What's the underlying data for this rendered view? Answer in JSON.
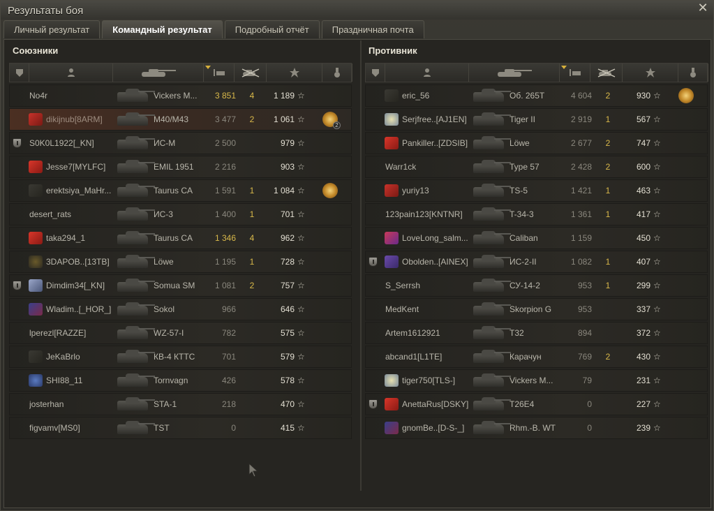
{
  "window": {
    "title": "Результаты боя"
  },
  "tabs": [
    {
      "label": "Личный результат",
      "active": false
    },
    {
      "label": "Командный результат",
      "active": true
    },
    {
      "label": "Подробный отчёт",
      "active": false
    },
    {
      "label": "Праздничная почта",
      "active": false
    }
  ],
  "colors": {
    "accent": "#d9b94a",
    "self_row": "#4b2f22",
    "row_bg": "#2a2824"
  },
  "header_icons": [
    "squad-icon",
    "player-icon",
    "tank-icon",
    "damage-icon",
    "kills-icon",
    "xp-star-icon",
    "medal-icon"
  ],
  "allies": {
    "title": "Союзники",
    "rows": [
      {
        "name": "No4r",
        "tank": "Vickers M...",
        "xp": "3 851",
        "xp_hi": true,
        "kills": "4",
        "points": "1 189",
        "squad": false,
        "badge": "",
        "medal": false,
        "self": false
      },
      {
        "name": "dikijnub[8ARM]",
        "tank": "M40/M43",
        "xp": "3 477",
        "xp_hi": false,
        "kills": "2",
        "points": "1 061",
        "squad": false,
        "badge": "ribbon-red-badge",
        "medal": true,
        "medal_count": "2",
        "self": true
      },
      {
        "name": "S0K0L1922[_KN]",
        "tank": "ИС-М",
        "xp": "2 500",
        "xp_hi": false,
        "kills": "",
        "points": "979",
        "squad": true,
        "badge": "",
        "medal": false,
        "self": false
      },
      {
        "name": "Jesse7[MYLFC]",
        "tank": "EMIL 1951",
        "xp": "2 216",
        "xp_hi": false,
        "kills": "",
        "points": "903",
        "squad": false,
        "badge": "flag-red-badge",
        "medal": false,
        "self": false
      },
      {
        "name": "erektsiya_MaHr...",
        "tank": "Taurus CA",
        "xp": "1 591",
        "xp_hi": false,
        "kills": "1",
        "points": "1 084",
        "squad": false,
        "badge": "diamond-badge",
        "medal": true,
        "self": false
      },
      {
        "name": "desert_rats",
        "tank": "ИС-3",
        "xp": "1 400",
        "xp_hi": false,
        "kills": "1",
        "points": "701",
        "squad": false,
        "badge": "",
        "medal": false,
        "self": false
      },
      {
        "name": "taka294_1",
        "tank": "Taurus CA",
        "xp": "1 346",
        "xp_hi": true,
        "kills": "4",
        "points": "962",
        "squad": false,
        "badge": "flag-red-badge",
        "medal": false,
        "self": false
      },
      {
        "name": "3DAPOB..[13TB]",
        "tank": "Löwe",
        "xp": "1 195",
        "xp_hi": false,
        "kills": "1",
        "points": "728",
        "squad": false,
        "badge": "gold-ring-badge",
        "medal": false,
        "self": false
      },
      {
        "name": "Dimdim34[_KN]",
        "tank": "Somua SM",
        "xp": "1 081",
        "xp_hi": false,
        "kills": "2",
        "points": "757",
        "squad": true,
        "badge": "cube-badge",
        "medal": false,
        "self": false
      },
      {
        "name": "Wladim..[_HOR_]",
        "tank": "Sokol",
        "xp": "966",
        "xp_hi": false,
        "kills": "",
        "points": "646",
        "squad": false,
        "badge": "blue-stripe-badge",
        "medal": false,
        "self": false
      },
      {
        "name": "lperezl[RAZZE]",
        "tank": "WZ-57-I",
        "xp": "782",
        "xp_hi": false,
        "kills": "",
        "points": "575",
        "squad": false,
        "badge": "",
        "medal": false,
        "self": false
      },
      {
        "name": "JeKaBrlo",
        "tank": "КВ-4 КТТС",
        "xp": "701",
        "xp_hi": false,
        "kills": "",
        "points": "579",
        "squad": false,
        "badge": "diamond-badge",
        "medal": false,
        "self": false
      },
      {
        "name": "SHI88_11",
        "tank": "Tornvagn",
        "xp": "426",
        "xp_hi": false,
        "kills": "",
        "points": "578",
        "squad": false,
        "badge": "t-circle-badge",
        "medal": false,
        "self": false
      },
      {
        "name": "josterhan",
        "tank": "STA-1",
        "xp": "218",
        "xp_hi": false,
        "kills": "",
        "points": "470",
        "squad": false,
        "badge": "",
        "medal": false,
        "self": false
      },
      {
        "name": "figvamv[MS0]",
        "tank": "TST",
        "xp": "0",
        "xp_hi": false,
        "kills": "",
        "points": "415",
        "squad": false,
        "badge": "",
        "medal": false,
        "self": false
      }
    ]
  },
  "enemies": {
    "title": "Противник",
    "rows": [
      {
        "name": "eric_56",
        "tank": "Об. 265Т",
        "xp": "4 604",
        "xp_hi": false,
        "kills": "2",
        "points": "930",
        "squad": false,
        "badge": "diamond-badge",
        "medal": true,
        "self": false
      },
      {
        "name": "Serjfree..[AJ1EN]",
        "tank": "Tiger II",
        "xp": "2 919",
        "xp_hi": false,
        "kills": "1",
        "points": "567",
        "squad": false,
        "badge": "star-burst-badge",
        "medal": false,
        "self": false
      },
      {
        "name": "Pankiller..[ZDSIB]",
        "tank": "Löwe",
        "xp": "2 677",
        "xp_hi": false,
        "kills": "2",
        "points": "747",
        "squad": false,
        "badge": "flag-red-badge",
        "medal": false,
        "self": false
      },
      {
        "name": "Warr1ck",
        "tank": "Type 57",
        "xp": "2 428",
        "xp_hi": false,
        "kills": "2",
        "points": "600",
        "squad": false,
        "badge": "",
        "medal": false,
        "self": false
      },
      {
        "name": "yuriy13",
        "tank": "TS-5",
        "xp": "1 421",
        "xp_hi": false,
        "kills": "1",
        "points": "463",
        "squad": false,
        "badge": "red-star-badge",
        "medal": false,
        "self": false
      },
      {
        "name": "123pain123[KNTNR]",
        "tank": "T-34-3",
        "xp": "1 361",
        "xp_hi": false,
        "kills": "1",
        "points": "417",
        "squad": false,
        "badge": "",
        "medal": false,
        "self": false
      },
      {
        "name": "LoveLong_salm...",
        "tank": "Caliban",
        "xp": "1 159",
        "xp_hi": false,
        "kills": "",
        "points": "450",
        "squad": false,
        "badge": "love-badge",
        "medal": false,
        "self": false
      },
      {
        "name": "Obolden..[AINEX]",
        "tank": "ИС-2-II",
        "xp": "1 082",
        "xp_hi": false,
        "kills": "1",
        "points": "407",
        "squad": true,
        "badge": "purple-badge",
        "medal": false,
        "self": false
      },
      {
        "name": "S_Serrsh",
        "tank": "СУ-14-2",
        "xp": "953",
        "xp_hi": false,
        "kills": "1",
        "points": "299",
        "squad": false,
        "badge": "",
        "medal": false,
        "self": false
      },
      {
        "name": "MedKent",
        "tank": "Skorpion G",
        "xp": "953",
        "xp_hi": false,
        "kills": "",
        "points": "337",
        "squad": false,
        "badge": "",
        "medal": false,
        "self": false
      },
      {
        "name": "Artem1612921",
        "tank": "T32",
        "xp": "894",
        "xp_hi": false,
        "kills": "",
        "points": "372",
        "squad": false,
        "badge": "",
        "medal": false,
        "self": false
      },
      {
        "name": "abcand1[L1TE]",
        "tank": "Карачун",
        "xp": "769",
        "xp_hi": false,
        "kills": "2",
        "points": "430",
        "squad": false,
        "badge": "",
        "medal": false,
        "self": false
      },
      {
        "name": "tiger750[TLS-]",
        "tank": "Vickers M...",
        "xp": "79",
        "xp_hi": false,
        "kills": "",
        "points": "231",
        "squad": false,
        "badge": "star-burst-badge",
        "medal": false,
        "self": false
      },
      {
        "name": "AnettaRus[DSKY]",
        "tank": "T26E4",
        "xp": "0",
        "xp_hi": false,
        "kills": "",
        "points": "227",
        "squad": true,
        "badge": "flag-red-badge",
        "medal": false,
        "self": false
      },
      {
        "name": "gnomBe..[D-S-_]",
        "tank": "Rhm.-B. WT",
        "xp": "0",
        "xp_hi": false,
        "kills": "",
        "points": "239",
        "squad": false,
        "badge": "blue-stripe-badge",
        "medal": false,
        "self": false
      }
    ]
  }
}
